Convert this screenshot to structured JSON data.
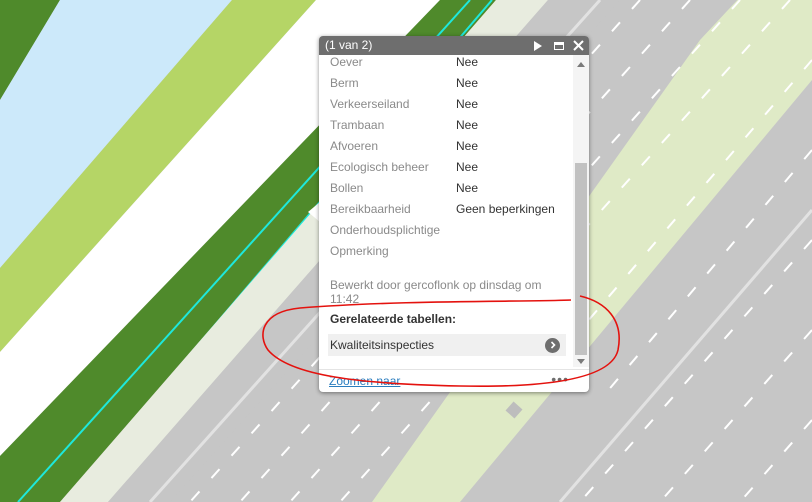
{
  "popup": {
    "header_title": "(1 van 2)",
    "attributes": [
      {
        "label": "Oever",
        "value": "Nee"
      },
      {
        "label": "Berm",
        "value": "Nee"
      },
      {
        "label": "Verkeerseiland",
        "value": "Nee"
      },
      {
        "label": "Trambaan",
        "value": "Nee"
      },
      {
        "label": "Afvoeren",
        "value": "Nee"
      },
      {
        "label": "Ecologisch beheer",
        "value": "Nee"
      },
      {
        "label": "Bollen",
        "value": "Nee"
      },
      {
        "label": "Bereikbaarheid",
        "value": "Geen beperkingen"
      },
      {
        "label": "Onderhoudsplichtige",
        "value": ""
      },
      {
        "label": "Opmerking",
        "value": ""
      }
    ],
    "edit_info": "Bewerkt door gercoflonk op dinsdag om 11:42",
    "related_tables_title": "Gerelateerde tabellen:",
    "related_item": "Kwaliteitsinspecties",
    "zoom_link": "Zoomen naar",
    "more_menu": "•••"
  },
  "colors": {
    "header_bg": "#6e6e6e",
    "map_grass_dark": "#4f8a2b",
    "map_grass_light": "#b5d566",
    "map_water": "#cce9fa",
    "map_road": "#c6c6c6",
    "map_verge": "#dfeac6",
    "highlight_outline": "#1ee8dc",
    "annotation_red": "#e4120e"
  },
  "icons": {
    "next": "play-triangle-icon",
    "maximize": "maximize-icon",
    "close": "close-icon",
    "related_chevron": "chevron-right-circle-icon",
    "scroll_up": "scroll-up-arrow-icon",
    "scroll_down": "scroll-down-arrow-icon"
  }
}
